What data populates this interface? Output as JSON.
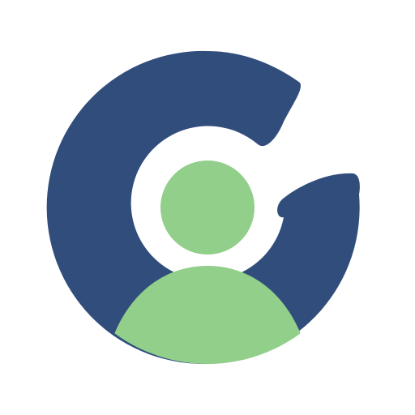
{
  "logo": {
    "icon": "c-letter-user-avatar-icon",
    "colors": {
      "background": "#ffffff",
      "ring": "#314d7c",
      "figure": "#91cf8b",
      "gap": "#ffffff"
    }
  }
}
